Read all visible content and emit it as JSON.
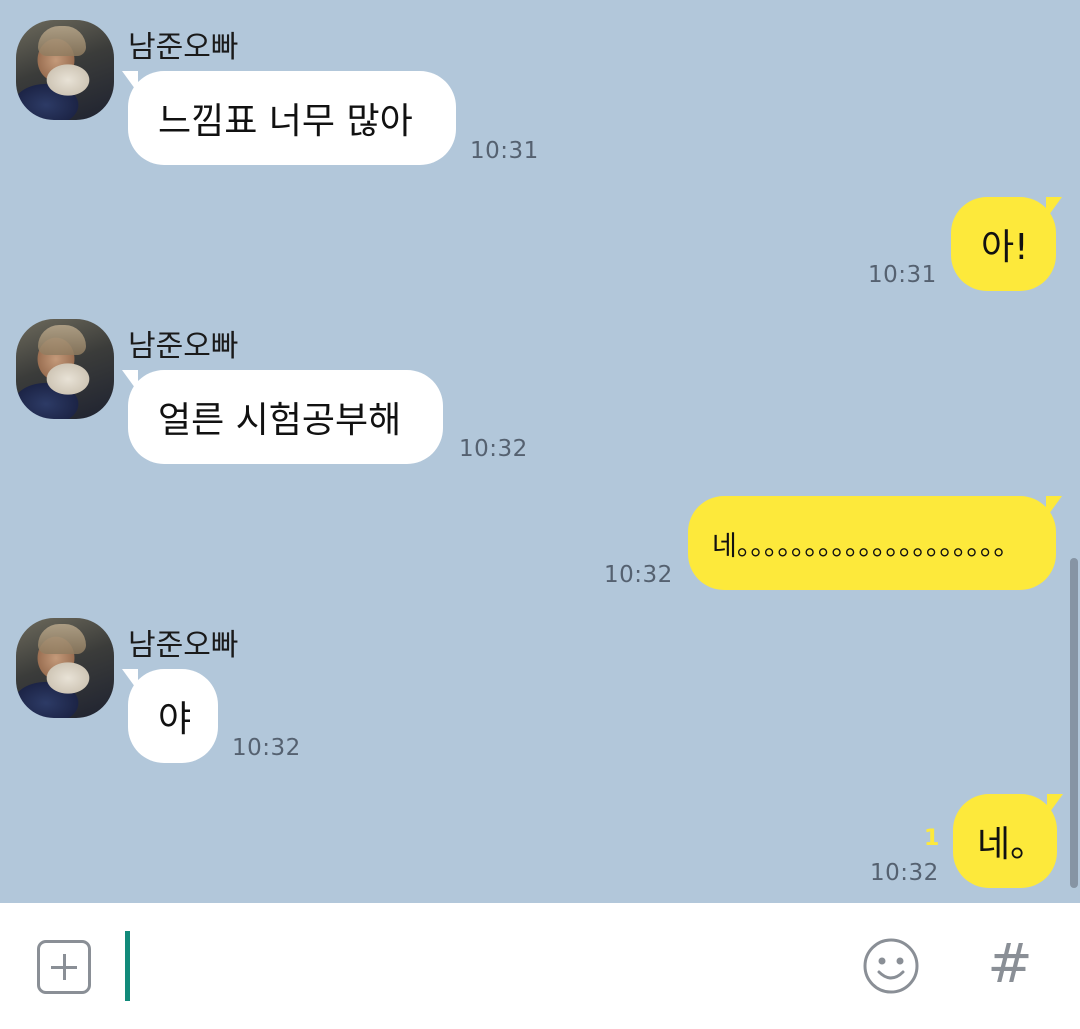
{
  "messages": [
    {
      "direction": "in",
      "sender": "남준오빠",
      "text": "느낌표 너무 많아",
      "time": "10:31"
    },
    {
      "direction": "out",
      "text": "아!",
      "time": "10:31"
    },
    {
      "direction": "in",
      "sender": "남준오빠",
      "text": "얼른 시험공부해",
      "time": "10:32"
    },
    {
      "direction": "out",
      "text": "네。。。。。。。。。。。。。。。。。。。。",
      "time": "10:32"
    },
    {
      "direction": "in",
      "sender": "남준오빠",
      "text": "야",
      "time": "10:32"
    },
    {
      "direction": "out",
      "text": "네。",
      "time": "10:32",
      "unread": "1"
    }
  ],
  "composer": {
    "input_value": "",
    "plus_icon": "plus-square-icon",
    "emoji_icon": "smiley-icon",
    "hash_icon": "hash-icon",
    "hash_glyph": "#"
  },
  "colors": {
    "background": "#b2c7da",
    "incoming_bubble": "#ffffff",
    "outgoing_bubble": "#fde93b",
    "caret": "#128a7a"
  }
}
